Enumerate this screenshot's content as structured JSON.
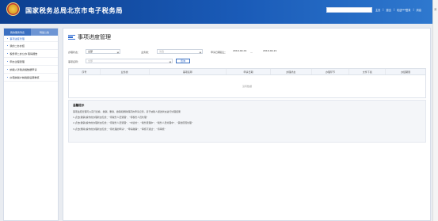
{
  "header": {
    "title": "国家税务总局北京市电子税务局",
    "search_placeholder": "",
    "links": [
      "主页",
      "|",
      "退出",
      "|",
      "欢迎***登录",
      "|",
      "消息"
    ]
  },
  "right_strip": {
    "label": "消"
  },
  "sidebar": {
    "tabs": [
      "我的服务列表",
      "附加公告"
    ],
    "items": [
      "事项进度管理",
      "我的二办办结",
      "税务师二办公办 取得报告",
      "申办过程受理",
      "纳税人涉税资格数据申请",
      "纠错纳税户纳税额后期重核"
    ]
  },
  "page": {
    "title": "事项进度管理"
  },
  "filters": {
    "status_label": "办理状态：",
    "status_value": "全部",
    "business_label": "业务类：",
    "business_placeholder": "请选",
    "date_label": "申请日期起止：",
    "date_from": "2019-02-01",
    "date_sep": "—",
    "date_to": "2019-02-21",
    "item_label": "事项名称：",
    "item_placeholder": "全部",
    "query_button": "查询"
  },
  "table": {
    "columns": [
      "序号",
      "业务类",
      "事项名称",
      "申请日期",
      "办理状态",
      "办理环节",
      "文件下载",
      "办结期限"
    ],
    "empty_text": "没有数据"
  },
  "tips": {
    "title": "温馨提示",
    "lines": [
      "事项进度管理可以实行查看、撤销、删除、撤销和删除保存的申请记录，基于纳税人报送状态进行处理结果",
      "1.点击[撤销]操作的办理状态包含：\"待税务人员受理\"、\"待税务人员处理\"",
      "2.点击[撤销]操作的办理状态包含：\"待税务人员受理\"、\"中途处\"、\"税务受理中\"、\"税务人员处理中\"、\"其他原因处理\"",
      "3.点击[删除]操作的办理状态包含：\"待处理的申请\"、\"申请撤销\"、\"审核不通过\"、\"待审核\""
    ]
  },
  "colors": {
    "header": "#1a5bb8",
    "accent": "#2f6bd0"
  }
}
